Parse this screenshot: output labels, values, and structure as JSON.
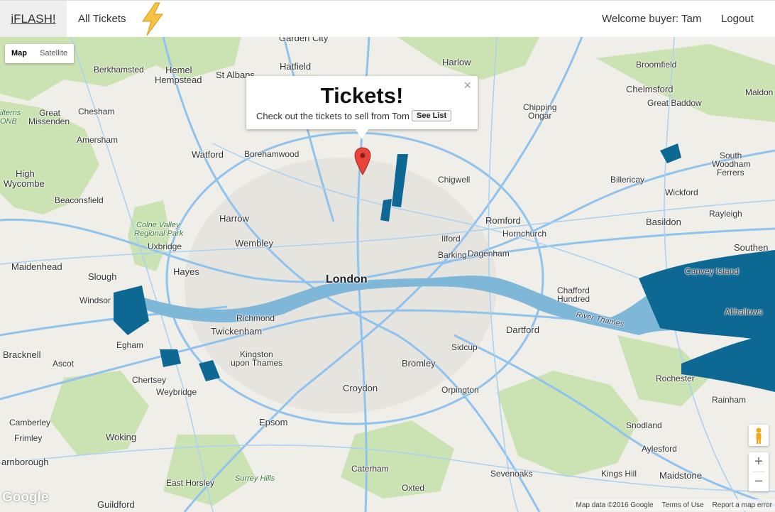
{
  "navbar": {
    "brand": "iFLASH!",
    "all_tickets": "All Tickets",
    "welcome": "Welcome buyer: Tam",
    "logout": "Logout"
  },
  "map": {
    "map_type": {
      "map": "Map",
      "satellite": "Satellite",
      "selected": "Map"
    },
    "info_window": {
      "title": "Tickets!",
      "text": "Check out the tickets to sell from Tom",
      "button": "See List",
      "close": "×"
    },
    "zoom": {
      "in": "+",
      "out": "−"
    },
    "logo": "Google",
    "attribution": {
      "data": "Map data ©2016 Google",
      "terms": "Terms of Use",
      "report": "Report a map error"
    },
    "labels": {
      "garden_city": "Garden City",
      "harlow": "Harlow",
      "hatfield": "Hatfield",
      "broomfield": "Broomfield",
      "berkhamsted": "Berkhamsted",
      "hemel": "Hemel",
      "hempstead": "Hempstead",
      "st_albans": "St Albans",
      "chelmsford": "Chelmsford",
      "maldon": "Maldon",
      "great_baddow": "Great Baddow",
      "chesham": "Chesham",
      "great": "Great",
      "missenden": "Missenden",
      "chipping": "Chipping",
      "ongar": "Ongar",
      "amersham": "Amersham",
      "watford": "Watford",
      "borehamwood": "Borehamwood",
      "south": "South",
      "woodham": "Woodham",
      "ferrers": "Ferrers",
      "high": "High",
      "wycombe": "Wycombe",
      "chigwell": "Chigwell",
      "billericay": "Billericay",
      "wickford": "Wickford",
      "beaconsfield": "Beaconsfield",
      "rayleigh": "Rayleigh",
      "harrow": "Harrow",
      "romford": "Romford",
      "basildon": "Basildon",
      "colne_valley": "Colne Valley",
      "regional_park": "Regional Park",
      "ilford": "Ilford",
      "hornchurch": "Hornchurch",
      "uxbridge": "Uxbridge",
      "wembley": "Wembley",
      "barking": "Barking",
      "dagenham": "Dagenham",
      "southend": "Southen",
      "maidenhead": "Maidenhead",
      "hayes": "Hayes",
      "slough": "Slough",
      "london": "London",
      "canvey_island": "Canvey Island",
      "windsor": "Windsor",
      "chafford": "Chafford",
      "hundred": "Hundred",
      "richmond": "Richmond",
      "allhallows": "Allhallows",
      "river_thames": "River Thames",
      "twickenham": "Twickenham",
      "dartford": "Dartford",
      "egham": "Egham",
      "bracknell": "Bracknell",
      "kingston": "Kingston",
      "upon_thames": "upon Thames",
      "sidcup": "Sidcup",
      "ascot": "Ascot",
      "bromley": "Bromley",
      "chertsey": "Chertsey",
      "rochester": "Rochester",
      "weybridge": "Weybridge",
      "croydon": "Croydon",
      "orpington": "Orpington",
      "rainham": "Rainham",
      "camberley": "Camberley",
      "epsom": "Epsom",
      "frimley": "Frimley",
      "woking": "Woking",
      "snodland": "Snodland",
      "aylesford": "Aylesford",
      "farnborough": "arnborough",
      "caterham": "Caterham",
      "sevenoaks": "Sevenoaks",
      "kings_hill": "Kings Hill",
      "maidstone": "Maidstone",
      "east_horsley": "East Horsley",
      "surrey_hills": "Surrey Hills",
      "oxted": "Oxted",
      "guildford": "Guildford",
      "chilterns": "ilterns",
      "aonb": "ONB"
    }
  },
  "colors": {
    "road": "#8fc3ee",
    "water": "#0e6894",
    "park": "#cbe3b3",
    "land": "#efeee8",
    "marker": "#e8443a"
  },
  "icons": {
    "bolt": "lightning-bolt-icon",
    "marker": "map-marker-icon",
    "pegman": "pegman-icon"
  }
}
